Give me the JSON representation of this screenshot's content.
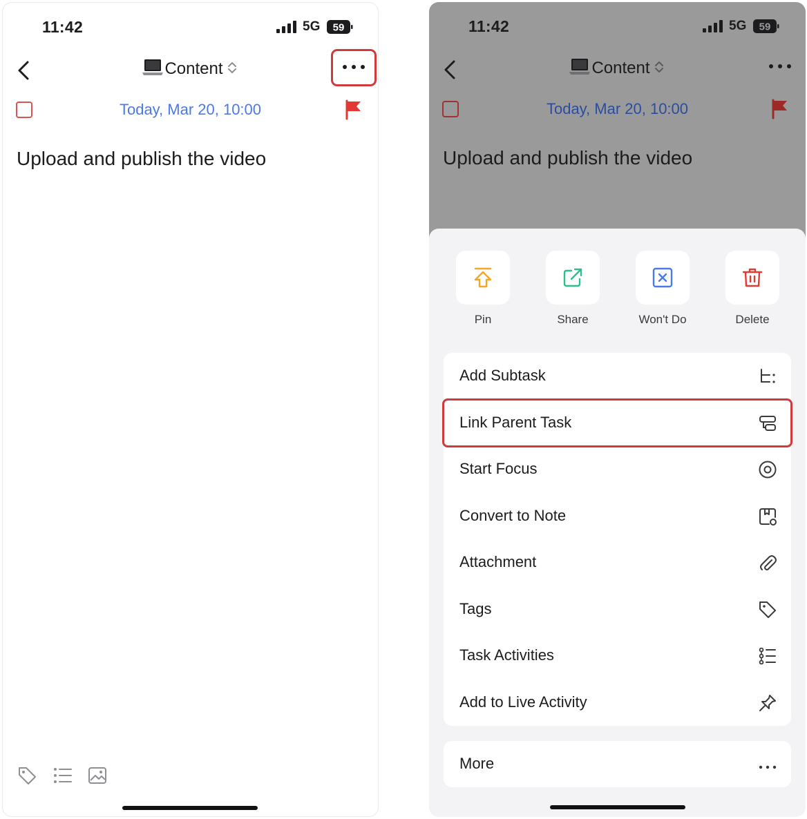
{
  "status_bar": {
    "time": "11:42",
    "network": "5G",
    "battery": "59"
  },
  "nav": {
    "list_title": "Content"
  },
  "task": {
    "due": "Today, Mar 20, 10:00",
    "title": "Upload and publish the video"
  },
  "colors": {
    "accent_blue": "#4a79e8",
    "flag_red": "#e03a32",
    "highlight": "#d03a3a"
  },
  "quick_actions": [
    {
      "label": "Pin",
      "icon": "pin-icon",
      "color": "#f5a623"
    },
    {
      "label": "Share",
      "icon": "share-icon",
      "color": "#2bbf8a"
    },
    {
      "label": "Won't Do",
      "icon": "wont-do-icon",
      "color": "#4a79e8"
    },
    {
      "label": "Delete",
      "icon": "trash-icon",
      "color": "#e03a32"
    }
  ],
  "menu": [
    {
      "label": "Add Subtask",
      "icon": "subtask-icon"
    },
    {
      "label": "Link Parent Task",
      "icon": "link-parent-icon",
      "highlighted": true
    },
    {
      "label": "Start Focus",
      "icon": "focus-icon"
    },
    {
      "label": "Convert to Note",
      "icon": "note-icon"
    },
    {
      "label": "Attachment",
      "icon": "paperclip-icon"
    },
    {
      "label": "Tags",
      "icon": "tag-icon"
    },
    {
      "label": "Task Activities",
      "icon": "activities-icon"
    },
    {
      "label": "Add to Live Activity",
      "icon": "pushpin-icon"
    }
  ],
  "more": {
    "label": "More"
  }
}
